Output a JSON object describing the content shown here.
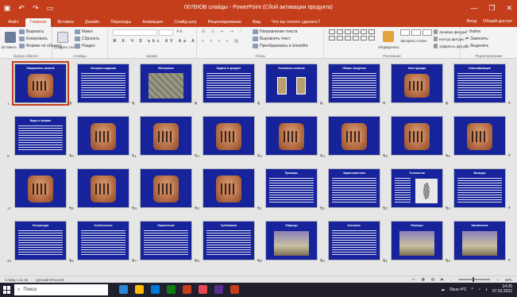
{
  "window": {
    "title": "007BIOB слайды - PowerPoint (Сбой активации продукта)",
    "qat": [
      "save-icon",
      "undo-icon",
      "redo-icon",
      "start-presentation-icon"
    ],
    "controls": [
      "—",
      "❐",
      "✕"
    ]
  },
  "tabs": [
    {
      "label": "Файл"
    },
    {
      "label": "Главная",
      "active": true
    },
    {
      "label": "Вставка"
    },
    {
      "label": "Дизайн"
    },
    {
      "label": "Переходы"
    },
    {
      "label": "Анимация"
    },
    {
      "label": "Слайд-шоу"
    },
    {
      "label": "Рецензирование"
    },
    {
      "label": "Вид"
    },
    {
      "label": "Что вы хотите сделать?"
    }
  ],
  "tabs_right": {
    "signin": "Вход",
    "share": "Общий доступ"
  },
  "ribbon": {
    "clipboard": {
      "label": "Буфер обмена",
      "paste": "Вставить",
      "cut": "Вырезать",
      "copy": "Копировать",
      "format": "Формат по образцу"
    },
    "slides": {
      "label": "Слайды",
      "new_slide": "Создать слайд",
      "layout": "Макет",
      "reset": "Сбросить",
      "section": "Раздел"
    },
    "font": {
      "label": "Шрифт"
    },
    "paragraph": {
      "label": "Абзац",
      "text_dir": "Направление текста",
      "align": "Выровнять текст",
      "smartart": "Преобразовать в SmartArt"
    },
    "drawing": {
      "label": "Рисование",
      "arrange": "Упорядочить",
      "quick_styles": "Экспресс-стили",
      "fill": "Заливка фигуры",
      "outline": "Контур фигуры",
      "effects": "Эффекты фигуры"
    },
    "editing": {
      "label": "Редактирование",
      "find": "Найти",
      "replace": "Заменить",
      "select": "Выделить"
    }
  },
  "slides": [
    {
      "n": "1",
      "title": "Лекционное занятие",
      "kind": "pic",
      "selected": true
    },
    {
      "n": "2",
      "title": "История создания",
      "kind": "text"
    },
    {
      "n": "3",
      "title": "Материалы",
      "kind": "stone"
    },
    {
      "n": "4",
      "title": "Задачи и предмет",
      "kind": "text"
    },
    {
      "n": "5",
      "title": "Основные понятия",
      "kind": "squares"
    },
    {
      "n": "6",
      "title": "Общие сведения",
      "kind": "text"
    },
    {
      "n": "7",
      "title": "Конструкция",
      "kind": "pic"
    },
    {
      "n": "8",
      "title": "Классификация",
      "kind": "text"
    },
    {
      "n": "9",
      "title": "Виды и формы",
      "kind": "text"
    },
    {
      "n": "10",
      "title": "",
      "kind": "pic"
    },
    {
      "n": "11",
      "title": "",
      "kind": "pic"
    },
    {
      "n": "12",
      "title": "",
      "kind": "pic"
    },
    {
      "n": "13",
      "title": "",
      "kind": "pic"
    },
    {
      "n": "14",
      "title": "",
      "kind": "pic"
    },
    {
      "n": "15",
      "title": "",
      "kind": "pic"
    },
    {
      "n": "16",
      "title": "",
      "kind": "pic"
    },
    {
      "n": "17",
      "title": "",
      "kind": "pic"
    },
    {
      "n": "18",
      "title": "",
      "kind": "pic"
    },
    {
      "n": "19",
      "title": "",
      "kind": "pic"
    },
    {
      "n": "20",
      "title": "",
      "kind": "pic"
    },
    {
      "n": "21",
      "title": "Примеры",
      "kind": "text"
    },
    {
      "n": "22",
      "title": "Характеристики",
      "kind": "text"
    },
    {
      "n": "23",
      "title": "Технология",
      "kind": "plant"
    },
    {
      "n": "24",
      "title": "Выводы",
      "kind": "text"
    },
    {
      "n": "25",
      "title": "Литература",
      "kind": "text"
    },
    {
      "n": "26",
      "title": "Особенности",
      "kind": "text"
    },
    {
      "n": "27",
      "title": "Применение",
      "kind": "text"
    },
    {
      "n": "28",
      "title": "Требования",
      "kind": "text"
    },
    {
      "n": "29",
      "title": "Образцы",
      "kind": "room"
    },
    {
      "n": "30",
      "title": "Контроль",
      "kind": "text"
    },
    {
      "n": "31",
      "title": "Размеры",
      "kind": "room"
    },
    {
      "n": "32",
      "title": "Заключение",
      "kind": "room"
    }
  ],
  "status": {
    "slide_count": "Слайд 1 из 32",
    "language": "русский (Россия)",
    "zoom": "80%"
  },
  "taskbar": {
    "search_placeholder": "Поиск",
    "apps": [
      "#2b88d8",
      "#ffb900",
      "#0078d7",
      "#107c10",
      "#c43e1c",
      "#e74856",
      "#5c2d91",
      "#c43e1c"
    ],
    "tray_text": "Ясно 4°C",
    "time": "14:35",
    "date": "07.02.2022"
  },
  "colors": {
    "accent": "#c43e1c",
    "slide_bg": "#16239a"
  }
}
